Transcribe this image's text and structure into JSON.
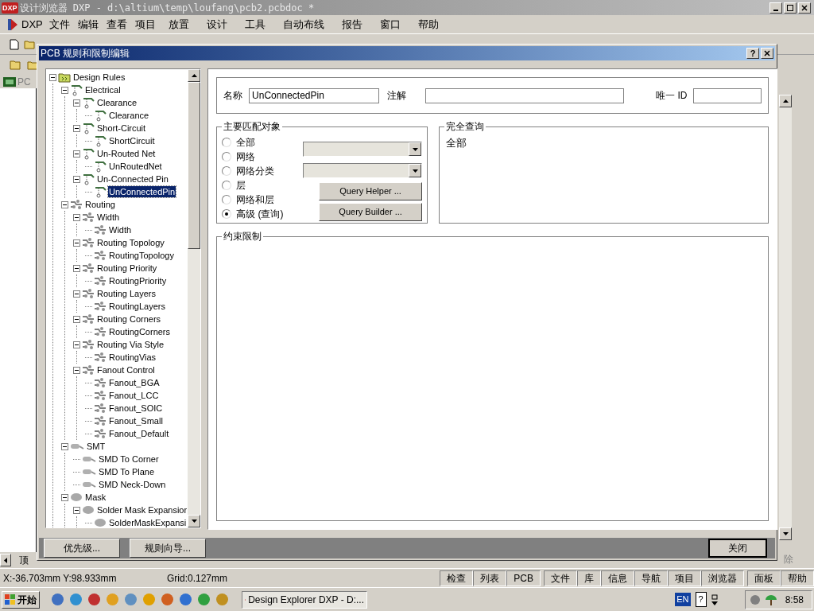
{
  "app": {
    "title": "设计浏览器 DXP - d:\\altium\\temp\\loufang\\pcb2.pcbdoc *",
    "logo": "DXP",
    "menu": [
      "DXP",
      "文件",
      "编辑",
      "查看",
      "项目",
      "放置",
      "设计",
      "工具",
      "自动布线",
      "报告",
      "窗口",
      "帮助"
    ],
    "doc_tab": "PC",
    "bottom_tab": "顶",
    "right_tab": "除"
  },
  "dialog": {
    "title": "PCB 规则和限制编辑",
    "help": "?",
    "tree": [
      {
        "label": "Design Rules",
        "kind": "folder",
        "expanded": true,
        "selected": false,
        "children": [
          {
            "label": "Electrical",
            "kind": "electrical",
            "expanded": true,
            "selected": false,
            "children": [
              {
                "label": "Clearance",
                "kind": "electrical",
                "expanded": true,
                "selected": false,
                "children": [
                  {
                    "label": "Clearance",
                    "kind": "electrical",
                    "selected": false
                  }
                ]
              },
              {
                "label": "Short-Circuit",
                "kind": "electrical",
                "expanded": true,
                "selected": false,
                "children": [
                  {
                    "label": "ShortCircuit",
                    "kind": "electrical",
                    "selected": false
                  }
                ]
              },
              {
                "label": "Un-Routed Net",
                "kind": "electrical",
                "expanded": true,
                "selected": false,
                "children": [
                  {
                    "label": "UnRoutedNet",
                    "kind": "electrical",
                    "selected": false
                  }
                ]
              },
              {
                "label": "Un-Connected Pin",
                "kind": "electrical",
                "expanded": true,
                "selected": false,
                "children": [
                  {
                    "label": "UnConnectedPin",
                    "kind": "electrical",
                    "selected": true
                  }
                ]
              }
            ]
          },
          {
            "label": "Routing",
            "kind": "routing",
            "expanded": true,
            "selected": false,
            "children": [
              {
                "label": "Width",
                "kind": "routing",
                "expanded": true,
                "selected": false,
                "children": [
                  {
                    "label": "Width",
                    "kind": "routing",
                    "selected": false
                  }
                ]
              },
              {
                "label": "Routing Topology",
                "kind": "routing",
                "expanded": true,
                "selected": false,
                "children": [
                  {
                    "label": "RoutingTopology",
                    "kind": "routing",
                    "selected": false
                  }
                ]
              },
              {
                "label": "Routing Priority",
                "kind": "routing",
                "expanded": true,
                "selected": false,
                "children": [
                  {
                    "label": "RoutingPriority",
                    "kind": "routing",
                    "selected": false
                  }
                ]
              },
              {
                "label": "Routing Layers",
                "kind": "routing",
                "expanded": true,
                "selected": false,
                "children": [
                  {
                    "label": "RoutingLayers",
                    "kind": "routing",
                    "selected": false
                  }
                ]
              },
              {
                "label": "Routing Corners",
                "kind": "routing",
                "expanded": true,
                "selected": false,
                "children": [
                  {
                    "label": "RoutingCorners",
                    "kind": "routing",
                    "selected": false
                  }
                ]
              },
              {
                "label": "Routing Via Style",
                "kind": "routing",
                "expanded": true,
                "selected": false,
                "children": [
                  {
                    "label": "RoutingVias",
                    "kind": "routing",
                    "selected": false
                  }
                ]
              },
              {
                "label": "Fanout Control",
                "kind": "routing",
                "expanded": true,
                "selected": false,
                "children": [
                  {
                    "label": "Fanout_BGA",
                    "kind": "routing",
                    "selected": false
                  },
                  {
                    "label": "Fanout_LCC",
                    "kind": "routing",
                    "selected": false
                  },
                  {
                    "label": "Fanout_SOIC",
                    "kind": "routing",
                    "selected": false
                  },
                  {
                    "label": "Fanout_Small",
                    "kind": "routing",
                    "selected": false
                  },
                  {
                    "label": "Fanout_Default",
                    "kind": "routing",
                    "selected": false
                  }
                ]
              }
            ]
          },
          {
            "label": "SMT",
            "kind": "smt",
            "expanded": true,
            "selected": false,
            "children": [
              {
                "label": "SMD To Corner",
                "kind": "smt",
                "selected": false
              },
              {
                "label": "SMD To Plane",
                "kind": "smt",
                "selected": false
              },
              {
                "label": "SMD Neck-Down",
                "kind": "smt",
                "selected": false
              }
            ]
          },
          {
            "label": "Mask",
            "kind": "mask",
            "expanded": true,
            "selected": false,
            "children": [
              {
                "label": "Solder Mask Expansior",
                "kind": "mask",
                "expanded": true,
                "selected": false,
                "children": [
                  {
                    "label": "SolderMaskExpansi",
                    "kind": "mask",
                    "selected": false
                  }
                ]
              }
            ]
          }
        ]
      }
    ],
    "name_label": "名称",
    "name_value": "UnConnectedPin",
    "comment_label": "注解",
    "id_label": "唯一 ID",
    "match": {
      "title": "主要匹配对象",
      "options": [
        {
          "label": "全部",
          "selected": false
        },
        {
          "label": "网络",
          "selected": false
        },
        {
          "label": "网络分类",
          "selected": false
        },
        {
          "label": "层",
          "selected": false
        },
        {
          "label": "网络和层",
          "selected": false
        },
        {
          "label": "高级 (查询)",
          "selected": true
        }
      ],
      "query_helper": "Query Helper ...",
      "query_builder": "Query Builder ..."
    },
    "query": {
      "title": "完全查询",
      "text": "全部"
    },
    "constraints": {
      "title": "约束限制"
    },
    "buttons": [
      "优先级...",
      "规则向导..."
    ],
    "close_button": "关闭"
  },
  "status": {
    "coords": "X:-36.703mm Y:98.933mm",
    "grid": "Grid:0.127mm",
    "panels": [
      "检查",
      "列表",
      "PCB",
      "文件",
      "库",
      "信息",
      "导航",
      "项目",
      "浏览器",
      "面板",
      "帮助"
    ]
  },
  "taskbar": {
    "start": "开始",
    "task": "Design Explorer DXP - D:...",
    "lang": "EN",
    "help": "?",
    "clock": "8:58"
  }
}
